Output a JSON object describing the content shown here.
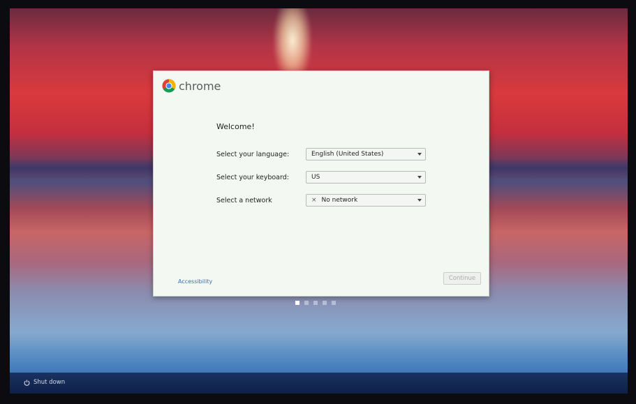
{
  "brand": {
    "name": "chrome",
    "logo_icon": "chrome-logo-icon"
  },
  "dialog": {
    "welcome": "Welcome!",
    "language_label": "Select your language:",
    "language_value": "English (United States)",
    "keyboard_label": "Select your keyboard:",
    "keyboard_value": "US",
    "network_label": "Select a network",
    "network_value": "No network",
    "accessibility_link": "Accessibility",
    "continue_label": "Continue"
  },
  "pager": {
    "total": 5,
    "active": 1
  },
  "taskbar": {
    "shutdown_label": "Shut down"
  },
  "colors": {
    "dialog_bg": "#f3f8f3",
    "link": "#3a6fb0",
    "disabled_text": "#a8aca8"
  }
}
